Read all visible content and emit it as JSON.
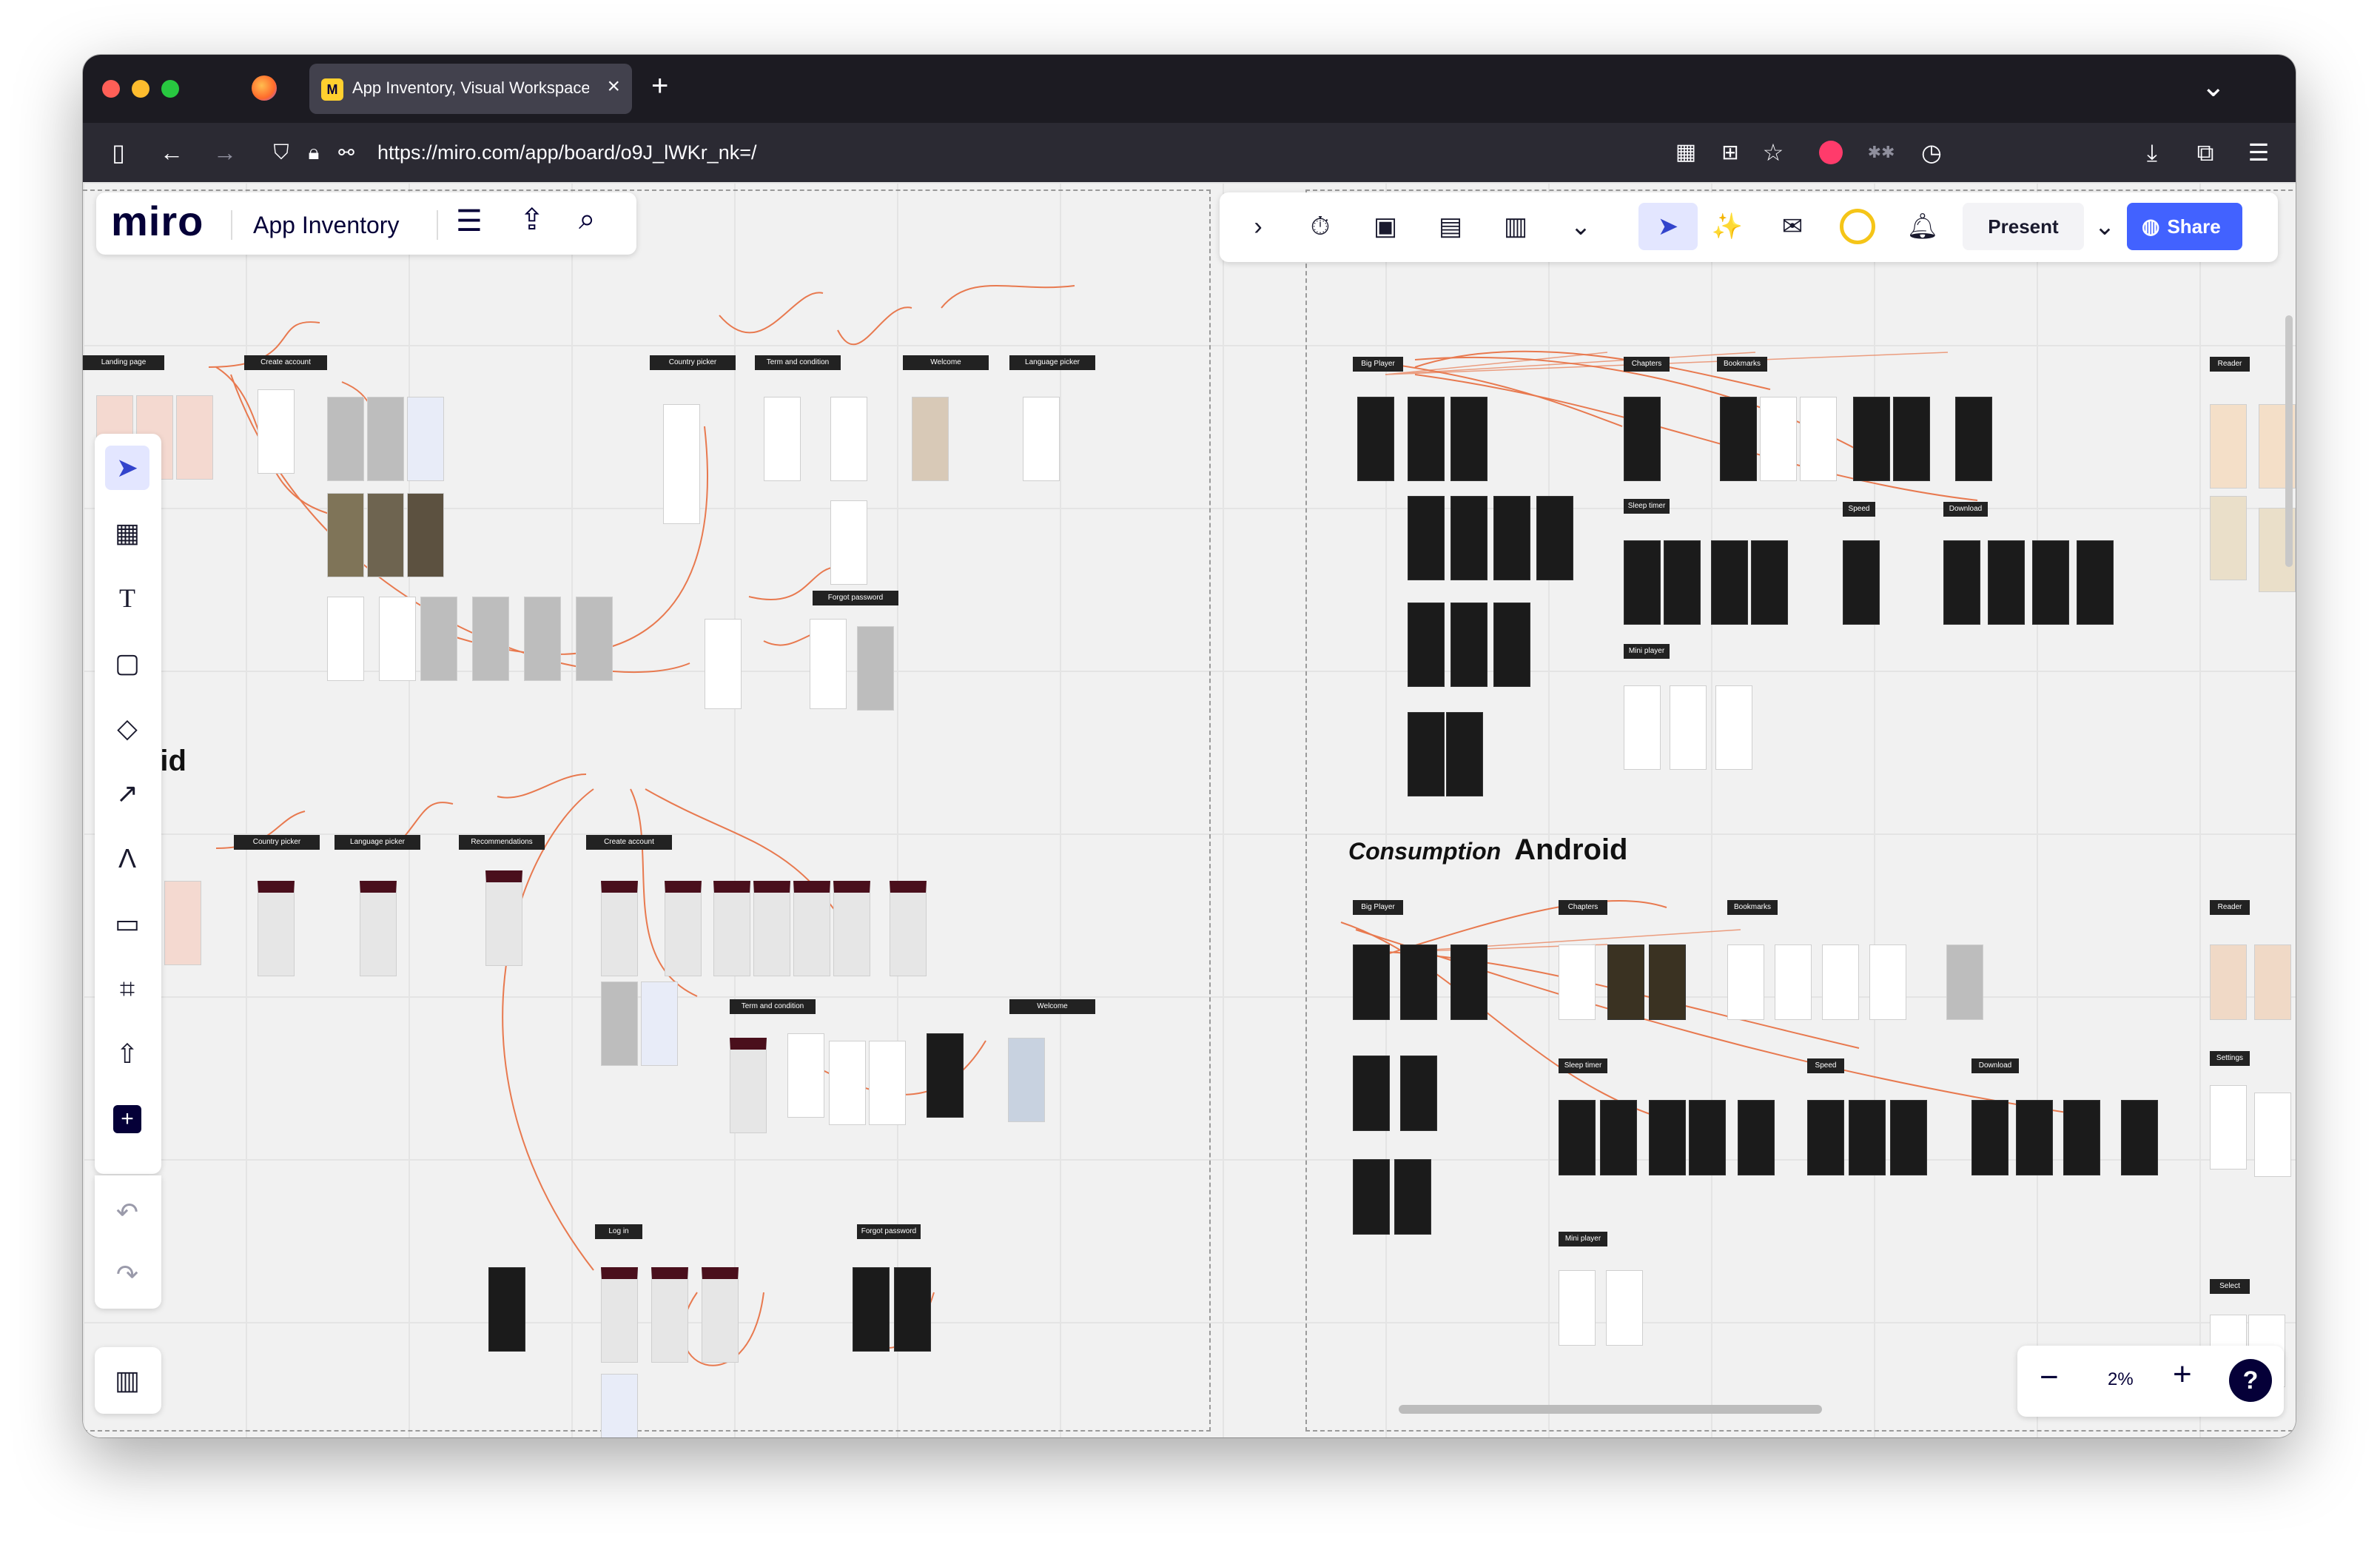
{
  "browser": {
    "tab_title": "App Inventory, Visual Workspace",
    "tab_favicon_letter": "M",
    "url": "https://miro.com/app/board/o9J_lWKr_nk=/",
    "new_tab": "+",
    "close": "×",
    "tab_list": "⌄"
  },
  "miro_header": {
    "logo": "miro",
    "board_name": "App Inventory"
  },
  "top_toolbar": {
    "present_label": "Present",
    "share_label": "Share"
  },
  "zoom": {
    "level": "2%",
    "minus": "−",
    "plus": "+",
    "help": "?"
  },
  "board": {
    "left_partial_heading": "oid",
    "consumption_heading_italic": "Consumption",
    "consumption_heading_platform": "Android",
    "left_ios_labels": [
      "Landing page",
      "Create account",
      "Country picker",
      "Term and condition",
      "Welcome",
      "Language picker",
      "Forgot password"
    ],
    "left_android_labels": [
      "Country picker",
      "Language picker",
      "Recommendations",
      "Create account",
      "Term and condition",
      "Welcome",
      "Log in",
      "Forgot password"
    ],
    "right_ios_labels": [
      "Big Player",
      "Chapters",
      "Bookmarks",
      "Sleep timer",
      "Speed",
      "Download",
      "Mini player",
      "Reader"
    ],
    "right_android_labels": [
      "Big Player",
      "Chapters",
      "Bookmarks",
      "Sleep timer",
      "Speed",
      "Download",
      "Mini player",
      "Reader",
      "Settings",
      "Select"
    ]
  },
  "colors": {
    "accent": "#4262ff",
    "connector": "#e8794f",
    "canvas_bg": "#f1f1f1",
    "chrome_dark": "#1c1b22"
  }
}
